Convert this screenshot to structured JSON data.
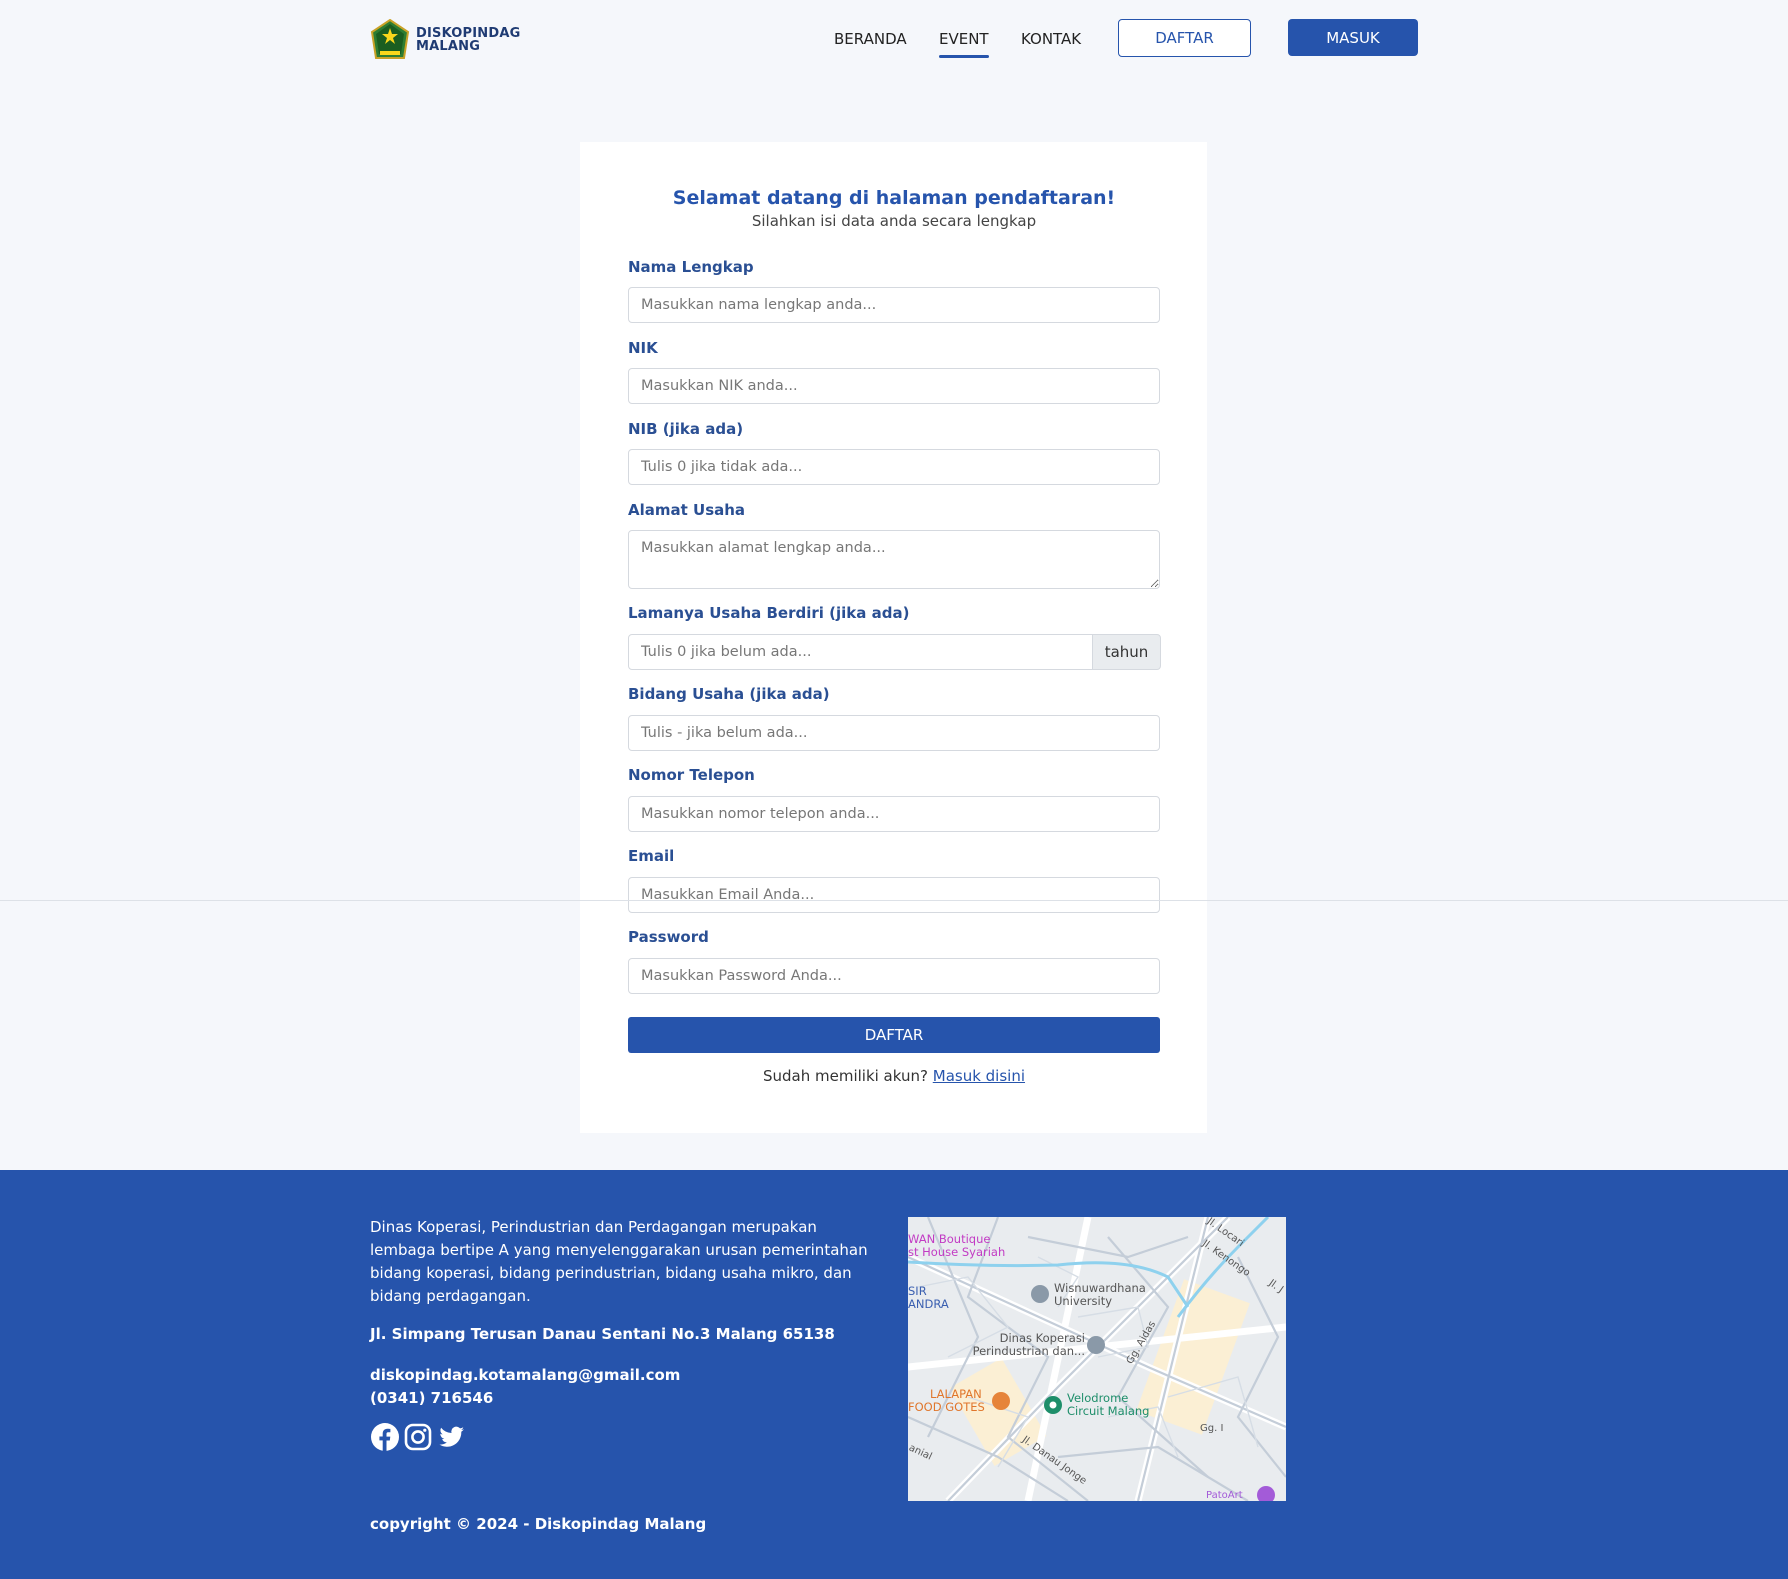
{
  "brand": {
    "name_line1": "DISKOPINDAG",
    "name_line2": "MALANG"
  },
  "nav": {
    "links": [
      {
        "label": "BERANDA"
      },
      {
        "label": "EVENT",
        "active": true
      },
      {
        "label": "KONTAK"
      }
    ],
    "register_label": "DAFTAR",
    "login_label": "MASUK"
  },
  "form": {
    "title": "Selamat datang di halaman pendaftaran!",
    "subtitle": "Silahkan isi data anda secara lengkap",
    "fields": [
      {
        "label": "Nama Lengkap",
        "placeholder": "Masukkan nama lengkap anda..."
      },
      {
        "label": "NIK",
        "placeholder": "Masukkan NIK anda..."
      },
      {
        "label": "NIB (jika ada)",
        "placeholder": "Tulis 0 jika tidak ada..."
      },
      {
        "label": "Alamat Usaha",
        "placeholder": "Masukkan alamat lengkap anda..."
      },
      {
        "label": "Lamanya Usaha Berdiri (jika ada)",
        "placeholder": "Tulis 0 jika belum ada...",
        "addon": "tahun"
      },
      {
        "label": "Bidang Usaha (jika ada)",
        "placeholder": "Tulis - jika belum ada..."
      },
      {
        "label": "Nomor Telepon",
        "placeholder": "Masukkan nomor telepon anda..."
      },
      {
        "label": "Email",
        "placeholder": "Masukkan Email Anda..."
      },
      {
        "label": "Password",
        "placeholder": "Masukkan Password Anda..."
      }
    ],
    "submit_label": "DAFTAR",
    "login_prompt": "Sudah memiliki akun?",
    "login_link": "Masuk disini"
  },
  "footer": {
    "description": "Dinas Koperasi, Perindustrian dan Perdagangan merupakan lembaga bertipe A yang menyelenggarakan urusan pemerintahan bidang koperasi, bidang perindustrian, bidang usaha mikro, dan bidang perdagangan.",
    "address": "Jl. Simpang Terusan Danau Sentani No.3 Malang 65138",
    "email": "diskopindag.kotamalang@gmail.com",
    "phone": "(0341) 716546",
    "copyright": "copyright © 2024 - Diskopindag Malang",
    "socials": [
      "facebook-icon",
      "instagram-icon",
      "twitter-icon"
    ],
    "map_labels": {
      "wan_boutique": "WAN Boutique",
      "guest_house": "st House Syariah",
      "sir": "SIR",
      "andra": "ANDRA",
      "wisnuwardhana_1": "Wisnuwardhana",
      "wisnuwardhana_2": "University",
      "dinas_1": "Dinas Koperasi",
      "dinas_2": "Perindustrian dan...",
      "lalapan_1": "LALAPAN",
      "lalapan_2": "FOOD GOTES",
      "velodrome_1": "Velodrome",
      "velodrome_2": "Circuit Malang",
      "jl_locari": "Jl. Locari",
      "jl_kenongo": "Jl. Kenongo",
      "jl_j": "Jl. J",
      "gg_aidas": "Gg. Aidas",
      "gg_i": "Gg. I",
      "jl_danau_jonge": "Jl. Danau Jonge",
      "anial": "anial",
      "patoart": "PatoArt"
    }
  },
  "colors": {
    "primary": "#2654ac",
    "label": "#2a4f93",
    "background": "#f5f7fb"
  }
}
